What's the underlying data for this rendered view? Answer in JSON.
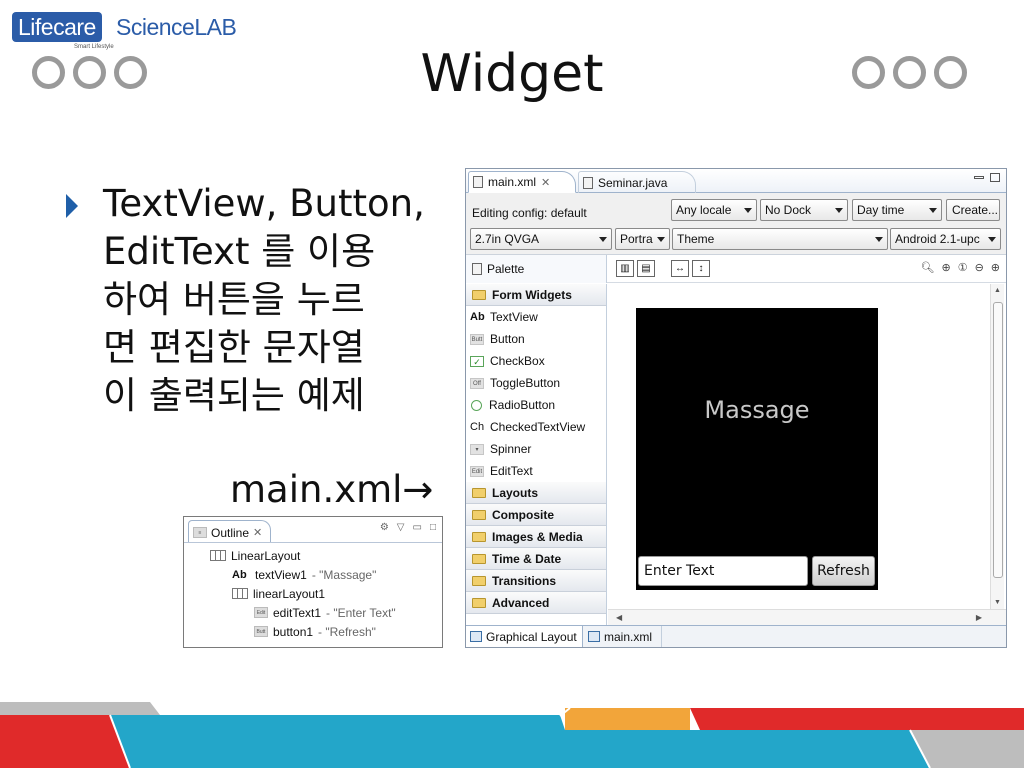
{
  "logo": {
    "brand_left": "Lifecare",
    "brand_right": "ScienceLAB",
    "tagline": "Smart Lifestyle"
  },
  "slide": {
    "title": "Widget",
    "bullet_lines": [
      "TextView, Button,",
      "EditText 를 이용",
      "하여 버튼을 누르",
      "면 편집한 문자열",
      "이 출력되는 예제"
    ],
    "xml_label": "main.xml→"
  },
  "outline": {
    "tab_label": "Outline",
    "tree": [
      {
        "label": "LinearLayout",
        "value": ""
      },
      {
        "label": "textView1",
        "value": " - \"Massage\""
      },
      {
        "label": "linearLayout1",
        "value": ""
      },
      {
        "label": "editText1",
        "value": " - \"Enter Text\""
      },
      {
        "label": "button1",
        "value": " - \"Refresh\""
      }
    ]
  },
  "editor": {
    "tabs": [
      "main.xml",
      "Seminar.java"
    ],
    "config_label": "Editing config: default",
    "locale": "Any locale",
    "dock": "No Dock",
    "daytime": "Day time",
    "create_label": "Create...",
    "screen": "2.7in QVGA",
    "orientation": "Portra",
    "theme": "Theme",
    "android_version": "Android 2.1-upc",
    "palette_label": "Palette",
    "categories_top": "Form Widgets",
    "widgets": [
      "TextView",
      "Button",
      "CheckBox",
      "ToggleButton",
      "RadioButton",
      "CheckedTextView",
      "Spinner",
      "EditText"
    ],
    "categories": [
      "Layouts",
      "Composite",
      "Images & Media",
      "Time & Date",
      "Transitions",
      "Advanced"
    ],
    "preview": {
      "text": "Massage",
      "input_value": "Enter Text",
      "button_label": "Refresh"
    },
    "bottom_tabs": [
      "Graphical Layout",
      "main.xml"
    ]
  },
  "colors": {
    "brand_blue": "#2b5ca8",
    "bullet": "#1f5fa8",
    "footer_red": "#e02a2a",
    "footer_teal": "#23a6c9",
    "footer_orange": "#f2a53a"
  }
}
